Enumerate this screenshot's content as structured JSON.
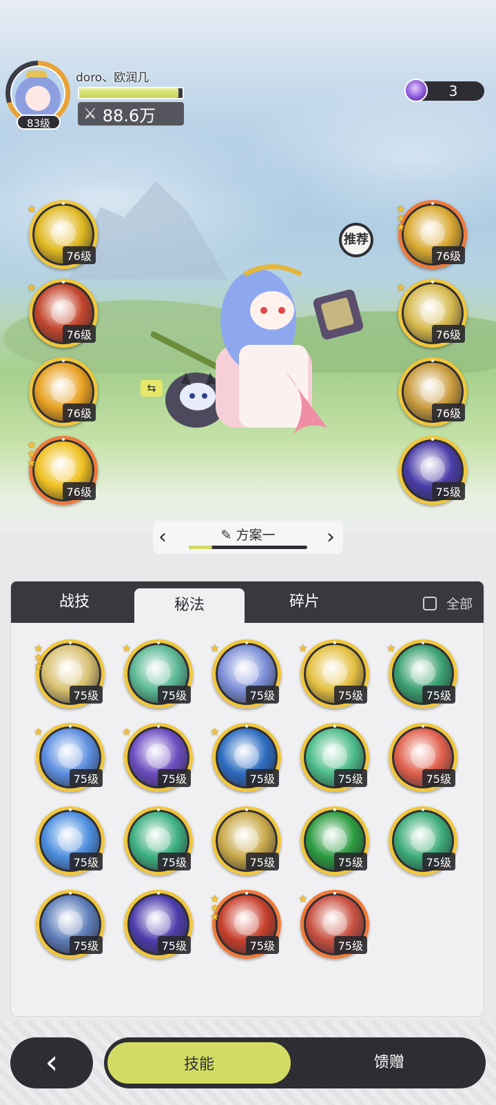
{
  "player": {
    "name": "doro、欧润几",
    "level": "83级",
    "power_icon": "crossed-swords-icon",
    "power": "88.6万",
    "hp_fraction": 0.96
  },
  "currency": {
    "icon": "purple-gem-icon",
    "count": "3"
  },
  "equipped": {
    "recommend_label": "推荐",
    "left": [
      {
        "icon": "lightning-burst-icon",
        "level": "76级",
        "stars": 1,
        "frame": "gold",
        "color": "#e0b820"
      },
      {
        "icon": "meteor-icon",
        "level": "76级",
        "stars": 1,
        "frame": "gold",
        "color": "#c2452c"
      },
      {
        "icon": "star-strike-icon",
        "level": "76级",
        "stars": 0,
        "frame": "gold",
        "color": "#e8a020"
      },
      {
        "icon": "sun-triangle-icon",
        "level": "76级",
        "stars": 3,
        "frame": "red",
        "color": "#f0c020"
      }
    ],
    "right": [
      {
        "icon": "radiant-burst-icon",
        "level": "76级",
        "stars": 3,
        "frame": "red",
        "color": "#d8a830"
      },
      {
        "icon": "rising-arrows-icon",
        "level": "76级",
        "stars": 1,
        "frame": "gold",
        "color": "#d6b84c"
      },
      {
        "icon": "shooting-star-icon",
        "level": "76级",
        "stars": 0,
        "frame": "gold",
        "color": "#c89a3c"
      },
      {
        "icon": "arcane-clock-icon",
        "level": "75级",
        "stars": 0,
        "frame": "gold",
        "color": "#4a3ca8"
      }
    ]
  },
  "plan": {
    "prev_icon": "chevron-left-icon",
    "next_icon": "chevron-right-icon",
    "edit_icon": "pencil-icon",
    "title": "方案一",
    "progress": 0.2
  },
  "tabs": [
    {
      "label": "战技",
      "active": false
    },
    {
      "label": "秘法",
      "active": true
    },
    {
      "label": "碎片",
      "active": false
    }
  ],
  "filter": {
    "label": "全部",
    "checked": false
  },
  "skills": [
    {
      "icon": "golden-figure-icon",
      "level": "75级",
      "stars": 3,
      "frame": "gold",
      "color": "#d8c070"
    },
    {
      "icon": "green-shield-icon",
      "level": "75级",
      "stars": 1,
      "frame": "gold",
      "color": "#5ab894"
    },
    {
      "icon": "blue-sparkle-icon",
      "level": "75级",
      "stars": 1,
      "frame": "gold",
      "color": "#7c8ed8"
    },
    {
      "icon": "golden-figure-icon",
      "level": "75级",
      "stars": 1,
      "frame": "gold",
      "color": "#e4c040"
    },
    {
      "icon": "green-heart-icon",
      "level": "75级",
      "stars": 1,
      "frame": "gold",
      "color": "#3aa070"
    },
    {
      "icon": "ice-spike-icon",
      "level": "75级",
      "stars": 1,
      "frame": "gold",
      "color": "#5c8ee0"
    },
    {
      "icon": "purple-swirl-icon",
      "level": "75级",
      "stars": 1,
      "frame": "gold",
      "color": "#6c4cc0"
    },
    {
      "icon": "blue-crystal-icon",
      "level": "75级",
      "stars": 1,
      "frame": "gold",
      "color": "#2c6cc0"
    },
    {
      "icon": "green-recycle-icon",
      "level": "75级",
      "stars": 0,
      "frame": "gold",
      "color": "#4cbc88"
    },
    {
      "icon": "red-figure-icon",
      "level": "75级",
      "stars": 0,
      "frame": "gold",
      "color": "#e0604c"
    },
    {
      "icon": "blue-figure-icon",
      "level": "75级",
      "stars": 0,
      "frame": "gold",
      "color": "#4c8ee0"
    },
    {
      "icon": "green-figure-icon",
      "level": "75级",
      "stars": 0,
      "frame": "gold",
      "color": "#3cb080"
    },
    {
      "icon": "golden-wing-icon",
      "level": "75级",
      "stars": 0,
      "frame": "gold",
      "color": "#c8a848"
    },
    {
      "icon": "green-wind-icon",
      "level": "75级",
      "stars": 0,
      "frame": "gold",
      "color": "#2c9c40"
    },
    {
      "icon": "green-chain-icon",
      "level": "75级",
      "stars": 0,
      "frame": "gold",
      "color": "#3cac78"
    },
    {
      "icon": "blue-crystal-armor-icon",
      "level": "75级",
      "stars": 0,
      "frame": "gold",
      "color": "#5c7cb8"
    },
    {
      "icon": "starry-portal-icon",
      "level": "75级",
      "stars": 0,
      "frame": "gold",
      "color": "#4c3cac"
    },
    {
      "icon": "red-flame-icon",
      "level": "75级",
      "stars": 3,
      "frame": "red",
      "color": "#c8402c"
    },
    {
      "icon": "red-vortex-icon",
      "level": "75级",
      "stars": 1,
      "frame": "red",
      "color": "#c85040"
    }
  ],
  "bottom": {
    "back_icon": "back-arrow-icon",
    "modes": [
      {
        "label": "技能",
        "active": true
      },
      {
        "label": "馈赠",
        "active": false
      }
    ]
  }
}
